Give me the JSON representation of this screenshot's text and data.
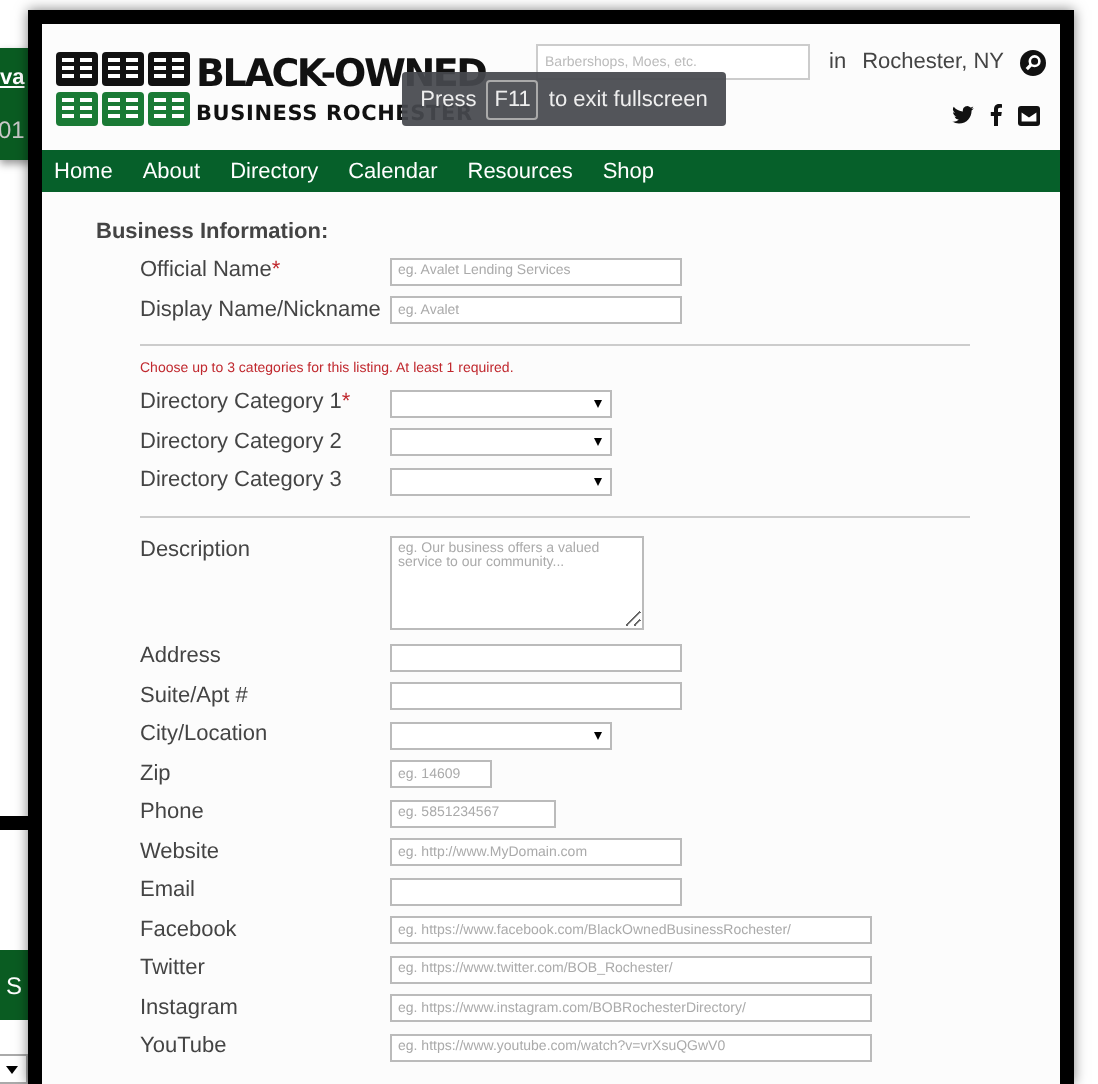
{
  "background_window": {
    "link": "va",
    "date": "01",
    "button": "S"
  },
  "header": {
    "logo_line_1": "BLACK-OWNED",
    "logo_line_2": "BUSINESS ROCHESTER",
    "search": {
      "placeholder": "Barbershops, Moes, etc."
    },
    "location_prefix": "in",
    "location": "Rochester, NY"
  },
  "toast": {
    "before": "Press",
    "key": "F11",
    "after": "to exit fullscreen"
  },
  "nav": [
    "Home",
    "About",
    "Directory",
    "Calendar",
    "Resources",
    "Shop"
  ],
  "form": {
    "heading": "Business Information:",
    "groups": [
      {
        "fields": [
          {
            "label": "Official Name",
            "required_mark": "*",
            "kind": "text",
            "placeholder": "eg. Avalet Lending Services"
          },
          {
            "label": "Display Name/Nickname",
            "kind": "text",
            "placeholder": "eg. Avalet"
          }
        ]
      },
      {
        "note": "Choose up to 3 categories for this listing. At least 1 required.",
        "fields": [
          {
            "label": "Directory Category 1",
            "required_mark": "*",
            "kind": "select"
          },
          {
            "label": "Directory Category 2",
            "kind": "select"
          },
          {
            "label": "Directory Category 3",
            "kind": "select"
          }
        ]
      },
      {
        "fields": [
          {
            "label": "Description",
            "kind": "textarea",
            "placeholder": "eg. Our business offers a valued service to our community..."
          },
          {
            "label": "Address",
            "kind": "text"
          },
          {
            "label": "Suite/Apt #",
            "kind": "text"
          },
          {
            "label": "City/Location",
            "kind": "select"
          },
          {
            "label": "Zip",
            "kind": "short",
            "placeholder": "eg. 14609"
          },
          {
            "label": "Phone",
            "kind": "medium",
            "placeholder": "eg. 5851234567"
          },
          {
            "label": "Website",
            "kind": "text",
            "placeholder": "eg. http://www.MyDomain.com"
          },
          {
            "label": "Email",
            "kind": "text"
          },
          {
            "label": "Facebook",
            "kind": "long",
            "placeholder": "eg. https://www.facebook.com/BlackOwnedBusinessRochester/"
          },
          {
            "label": "Twitter",
            "kind": "long",
            "placeholder": "eg. https://www.twitter.com/BOB_Rochester/"
          },
          {
            "label": "Instagram",
            "kind": "long",
            "placeholder": "eg. https://www.instagram.com/BOBRochesterDirectory/"
          },
          {
            "label": "YouTube",
            "kind": "long",
            "placeholder": "eg. https://www.youtube.com/watch?v=vrXsuQGwV0"
          }
        ]
      }
    ]
  }
}
